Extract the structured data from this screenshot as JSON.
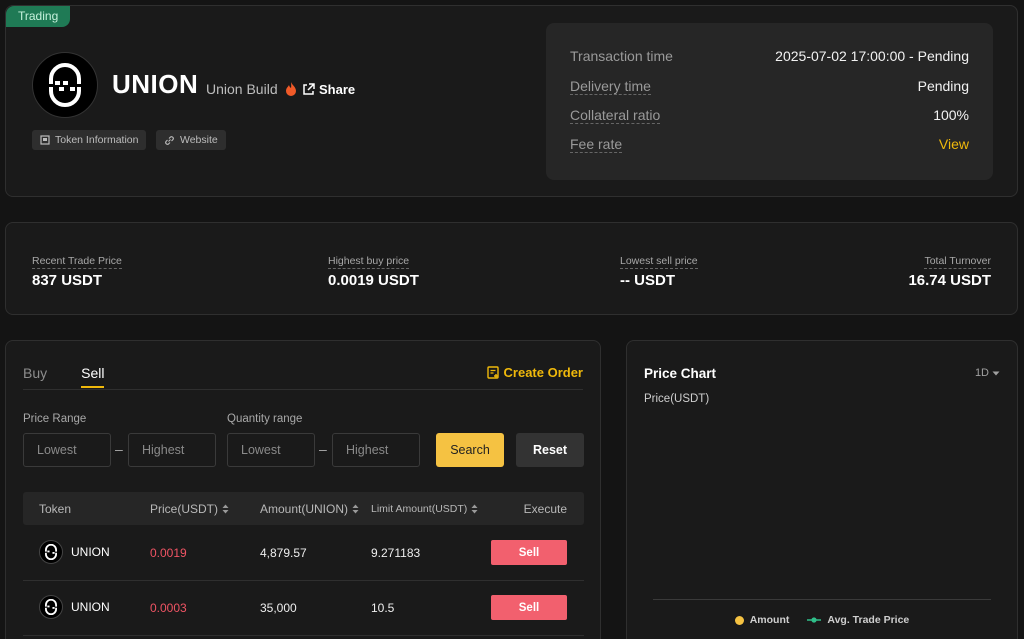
{
  "header": {
    "badge": "Trading",
    "token_name": "UNION",
    "token_subtitle": "Union Build",
    "share_label": "Share",
    "chips": {
      "token_info": "Token Information",
      "website": "Website"
    }
  },
  "info": {
    "rows": [
      {
        "label": "Transaction time",
        "value": "2025-07-02 17:00:00 - Pending"
      },
      {
        "label": "Delivery time",
        "value": "Pending"
      },
      {
        "label": "Collateral ratio",
        "value": "100%"
      },
      {
        "label": "Fee rate",
        "value": "View"
      }
    ]
  },
  "stats": [
    {
      "label": "Recent Trade Price",
      "value": "837 USDT"
    },
    {
      "label": "Highest buy price",
      "value": "0.0019 USDT"
    },
    {
      "label": "Lowest sell price",
      "value": "-- USDT"
    },
    {
      "label": "Total Turnover",
      "value": "16.74 USDT"
    }
  ],
  "orders": {
    "tabs": [
      "Buy",
      "Sell"
    ],
    "active_tab": "Sell",
    "create_order_label": "Create Order",
    "price_range_label": "Price Range",
    "quantity_range_label": "Quantity range",
    "placeholders": {
      "lowest": "Lowest",
      "highest": "Highest"
    },
    "search_label": "Search",
    "reset_label": "Reset",
    "columns": [
      "Token",
      "Price(USDT)",
      "Amount(UNION)",
      "Limit Amount(USDT)",
      "Execute"
    ],
    "rows": [
      {
        "token": "UNION",
        "price": "0.0019",
        "amount": "4,879.57",
        "limit": "9.271183",
        "action": "Sell"
      },
      {
        "token": "UNION",
        "price": "0.0003",
        "amount": "35,000",
        "limit": "10.5",
        "action": "Sell"
      }
    ]
  },
  "chart": {
    "title": "Price Chart",
    "range": "1D",
    "unit_label": "Price(USDT)",
    "legend": {
      "amount": "Amount",
      "avg": "Avg. Trade Price"
    },
    "colors": {
      "amount": "#f5c242",
      "avg": "#2fbf8a"
    }
  },
  "colors": {
    "accent": "#f0b90b",
    "sell": "#f2606e",
    "badge": "#1f7a55"
  }
}
